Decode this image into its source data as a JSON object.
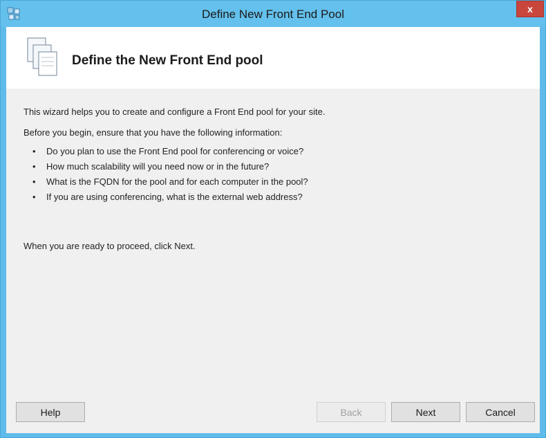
{
  "window": {
    "title": "Define New Front End Pool",
    "close_label": "x"
  },
  "header": {
    "title": "Define the New Front End pool"
  },
  "content": {
    "intro": "This wizard helps you to create and configure a Front End pool for your site.",
    "before": "Before you begin, ensure that you have the following information:",
    "bullets": [
      "Do you plan to use the Front End pool for conferencing or voice?",
      "How much scalability will you need now or in the future?",
      "What is the FQDN for the pool and for each computer in the pool?",
      "If you are using conferencing, what is the external web address?"
    ],
    "ready": "When you are ready to proceed, click Next."
  },
  "buttons": {
    "help": "Help",
    "back": "Back",
    "next": "Next",
    "cancel": "Cancel"
  },
  "colors": {
    "titlebar": "#64c0ec",
    "close": "#c9463d",
    "client_bg": "#f0f0f0"
  }
}
